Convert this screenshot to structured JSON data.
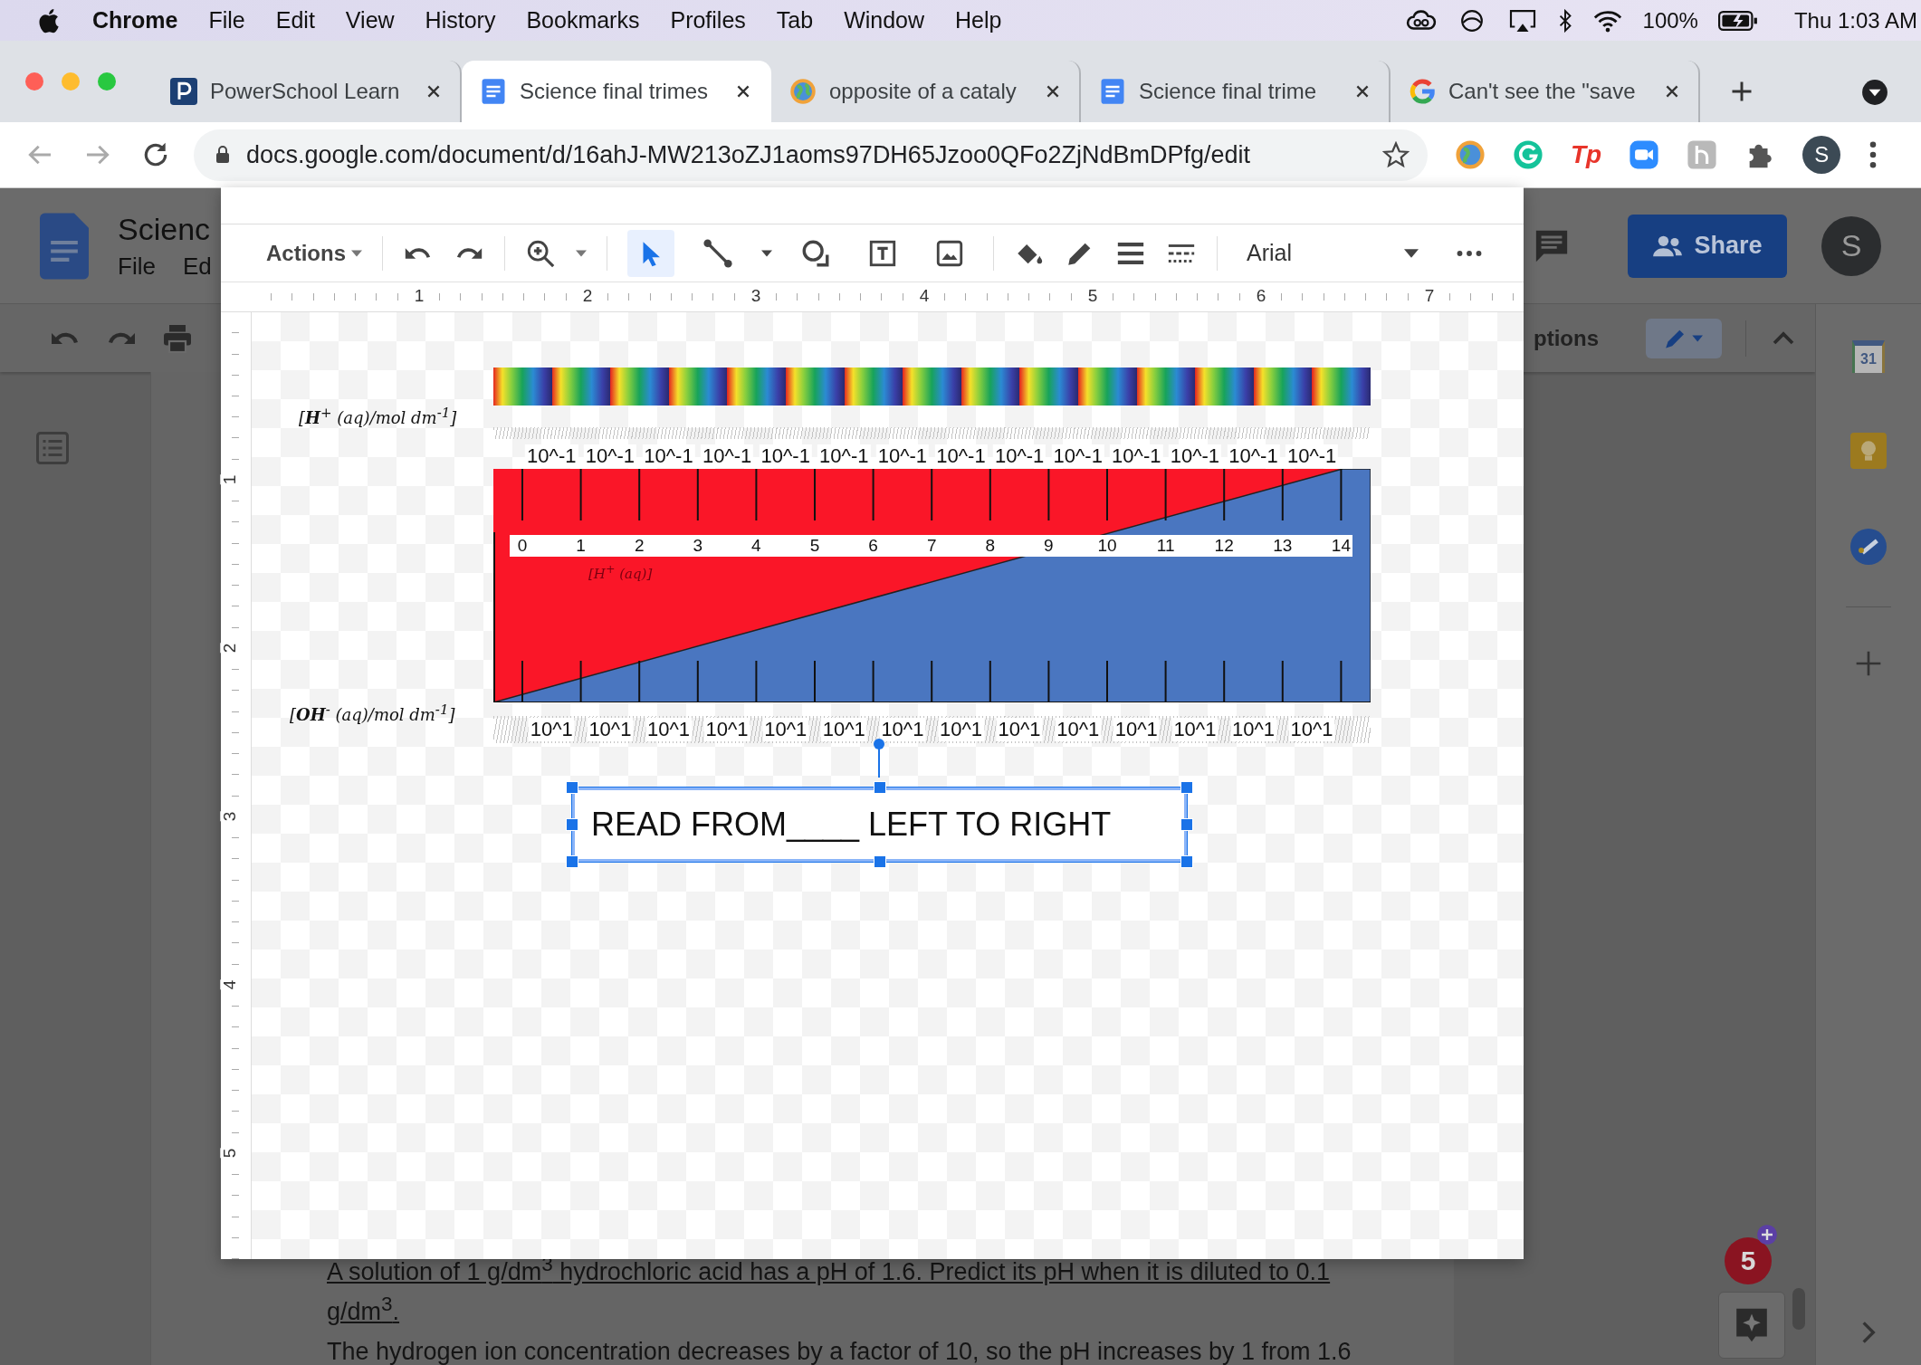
{
  "menu_bar": {
    "app": "Chrome",
    "items": [
      "File",
      "Edit",
      "View",
      "History",
      "Bookmarks",
      "Profiles",
      "Tab",
      "Window",
      "Help"
    ],
    "battery": "100%",
    "clock": "Thu 1:03 AM"
  },
  "tabs": [
    {
      "title": "PowerSchool Learn",
      "kind": "powerschool",
      "selected": false
    },
    {
      "title": "Science final trimes",
      "kind": "docs",
      "selected": true
    },
    {
      "title": "opposite of a cataly",
      "kind": "globe",
      "selected": false
    },
    {
      "title": "Science final trime",
      "kind": "docs",
      "selected": false
    },
    {
      "title": "Can't see the \"save",
      "kind": "google",
      "selected": false
    }
  ],
  "address_bar": {
    "url": "docs.google.com/document/d/16ahJ-MW213oZJ1aoms97DH65Jzoo0QFo2ZjNdBmDPfg/edit",
    "extension_text": "Tp",
    "profile": "S"
  },
  "docs": {
    "title": "Scienc",
    "menu": [
      "File",
      "Ed"
    ],
    "share": "Share",
    "avatar": "S",
    "mode_label": "ptions",
    "calendar_day": "31",
    "notifications": "5",
    "paragraphs": [
      {
        "text": "A solution of 1 g/dm$^{3}$ hydrochloric acid has a pH of 1.6. Predict its pH when it is diluted to 0.1 g/dm$^{3}$.",
        "underlined": true
      },
      {
        "text": "The hydrogen ion concentration decreases by a factor of 10, so the pH increases by 1 from 1.6",
        "underlined": false
      }
    ]
  },
  "drawing": {
    "toolbar": {
      "actions": "Actions",
      "font": "Arial",
      "tools": [
        {
          "kind": "select",
          "selected": true
        },
        {
          "kind": "line",
          "selected": false
        },
        {
          "kind": "shape",
          "selected": false
        },
        {
          "kind": "textbox",
          "selected": false
        },
        {
          "kind": "image",
          "selected": false
        }
      ]
    },
    "ruler": [
      "1",
      "2",
      "3",
      "4",
      "5",
      "6",
      "7"
    ],
    "vertical_ruler": [
      "1",
      "2",
      "3",
      "4",
      "5"
    ],
    "chart": {
      "h_axis_label": "[**H**$^{+}$ (aq)/mol dm$^{-1}$]",
      "oh_axis_label": "[**OH**$^{-}$ (aq)/mol dm$^{-1}$]",
      "inner_label": "[H$^{+}$ (aq)]",
      "top_labels": [
        "10^-1",
        "10^-1",
        "10^-1",
        "10^-1",
        "10^-1",
        "10^-1",
        "10^-1",
        "10^-1",
        "10^-1",
        "10^-1",
        "10^-1",
        "10^-1",
        "10^-1",
        "10^-1"
      ],
      "ph_numbers": [
        "0",
        "1",
        "2",
        "3",
        "4",
        "5",
        "6",
        "7",
        "8",
        "9",
        "10",
        "11",
        "12",
        "13",
        "14"
      ],
      "bottom_labels": [
        "10^1",
        "10^1",
        "10^1",
        "10^1",
        "10^1",
        "10^1",
        "10^1",
        "10^1",
        "10^1",
        "10^1",
        "10^1",
        "10^1",
        "10^1",
        "10^1"
      ]
    },
    "text_box": {
      "text": "READ FROM____ LEFT TO RIGHT",
      "selected": true
    }
  }
}
